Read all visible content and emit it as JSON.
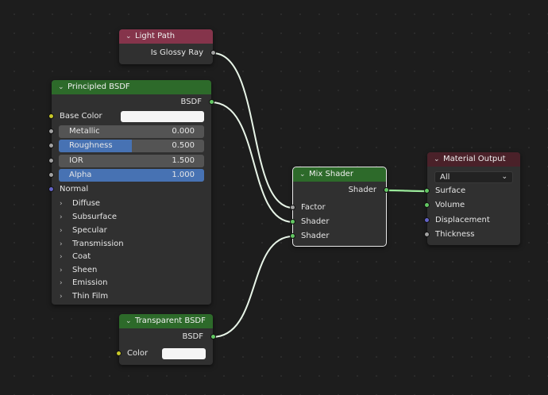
{
  "nodes": {
    "light_path": {
      "title": "Light Path",
      "outputs": {
        "is_glossy_ray": "Is Glossy Ray"
      }
    },
    "principled_bsdf": {
      "title": "Principled BSDF",
      "output": "BSDF",
      "base_color_label": "Base Color",
      "fields": {
        "metallic": {
          "label": "Metallic",
          "value": "0.000"
        },
        "roughness": {
          "label": "Roughness",
          "value": "0.500",
          "fraction": 0.5
        },
        "ior": {
          "label": "IOR",
          "value": "1.500"
        },
        "alpha": {
          "label": "Alpha",
          "value": "1.000",
          "fraction": 1.0
        }
      },
      "normal_label": "Normal",
      "panels": [
        "Diffuse",
        "Subsurface",
        "Specular",
        "Transmission",
        "Coat",
        "Sheen",
        "Emission",
        "Thin Film"
      ]
    },
    "transparent_bsdf": {
      "title": "Transparent BSDF",
      "output": "BSDF",
      "color_label": "Color"
    },
    "mix_shader": {
      "title": "Mix Shader",
      "output": "Shader",
      "inputs": {
        "factor": "Factor",
        "shader1": "Shader",
        "shader2": "Shader"
      }
    },
    "material_output": {
      "title": "Material Output",
      "target": "All",
      "inputs": {
        "surface": "Surface",
        "volume": "Volume",
        "displacement": "Displacement",
        "thickness": "Thickness"
      }
    }
  },
  "colors": {
    "shader_socket": "#63c763",
    "float_socket": "#a1a1a1",
    "color_socket": "#c7c729",
    "vector_socket": "#6363c7",
    "link": "#e8f5e8",
    "selected_link": "#9bea9b"
  },
  "icons": {
    "collapse": "chevron-down-icon",
    "panel": "chevron-right-icon",
    "dropdown": "chevron-down-icon"
  }
}
